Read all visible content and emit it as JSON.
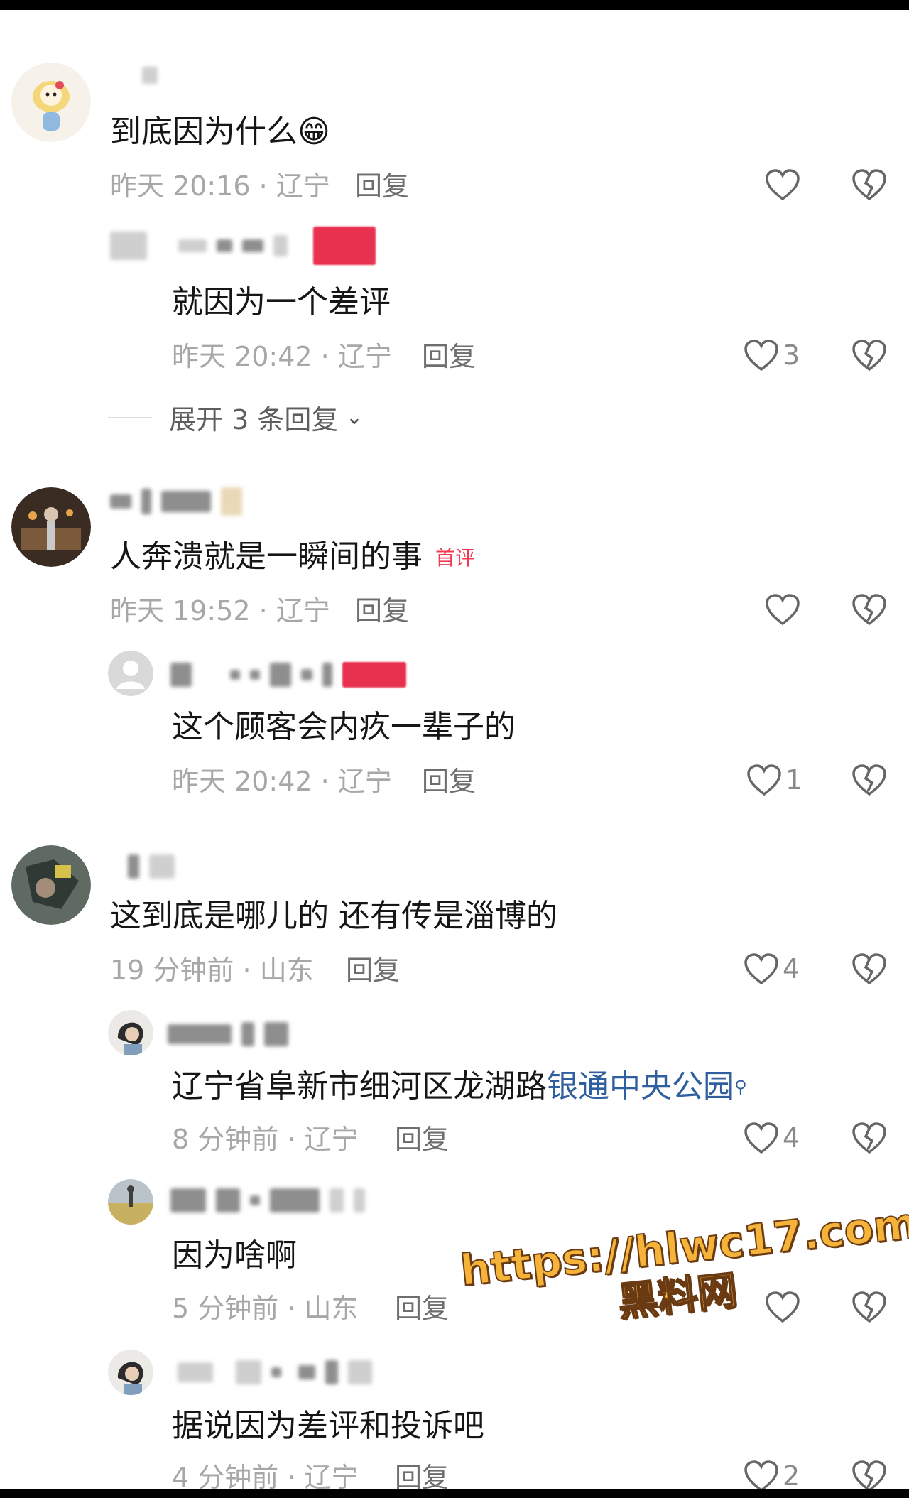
{
  "comments": [
    {
      "text": "到底因为什么",
      "emoji": "😁",
      "time": "昨天 20:16",
      "region": "辽宁",
      "reply_label": "回复",
      "likes": "",
      "replies": [
        {
          "text": "就因为一个差评",
          "time": "昨天 20:42",
          "region": "辽宁",
          "reply_label": "回复",
          "likes": "3"
        }
      ],
      "expand_label": "展开 3 条回复"
    },
    {
      "text": "人奔溃就是一瞬间的事",
      "tag": "首评",
      "time": "昨天 19:52",
      "region": "辽宁",
      "reply_label": "回复",
      "likes": "",
      "replies": [
        {
          "text": "这个顾客会内疚一辈子的",
          "time": "昨天 20:42",
          "region": "辽宁",
          "reply_label": "回复",
          "likes": "1"
        }
      ]
    },
    {
      "text": "这到底是哪儿的 还有传是淄博的",
      "time": "19 分钟前",
      "region": "山东",
      "reply_label": "回复",
      "likes": "4",
      "replies": [
        {
          "text_prefix": "辽宁省阜新市细河区龙湖路",
          "text_link": "银通中央公园",
          "time": "8 分钟前",
          "region": "辽宁",
          "reply_label": "回复",
          "likes": "4"
        },
        {
          "text": "因为啥啊",
          "time": "5 分钟前",
          "region": "山东",
          "reply_label": "回复",
          "likes": ""
        },
        {
          "text": "据说因为差评和投诉吧",
          "time": "4 分钟前",
          "region": "辽宁",
          "reply_label": "回复",
          "likes": "2"
        }
      ]
    }
  ],
  "watermark": {
    "url": "https://hlwc17.com",
    "name": "黑料网"
  },
  "colors": {
    "tag_red": "#f23a52",
    "link_blue": "#2f5f9e",
    "meta_gray": "#a7a7a7",
    "watermark_orange": "#f5b33a"
  },
  "icons": {
    "like": "heart-outline-icon",
    "dislike": "broken-heart-icon",
    "expand": "chevron-down-icon",
    "search": "search-icon"
  }
}
